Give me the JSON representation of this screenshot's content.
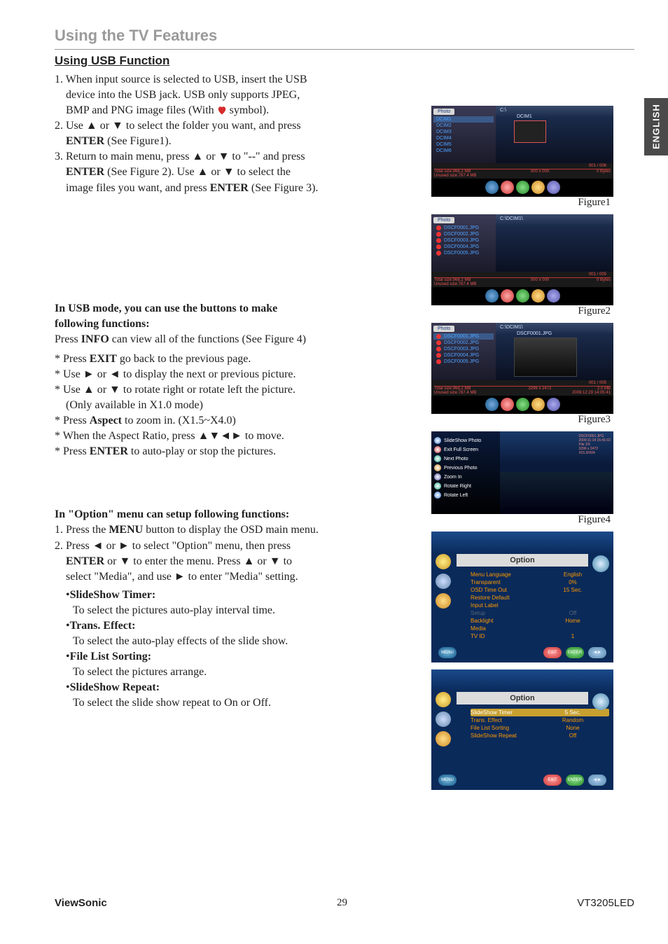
{
  "header": {
    "title": "Using the TV Features"
  },
  "section1": {
    "heading": "Using USB Function",
    "item1_a": "When input source is selected to USB, insert the USB",
    "item1_b": "device into the USB jack. USB only supports JPEG,",
    "item1_c_pre": "BMP and PNG image files (With ",
    "item1_c_post": " symbol).",
    "item2_a": "Use ▲ or ▼ to select the folder you want, and press",
    "item2_b_bold": "ENTER",
    "item2_b_rest": " (See Figure1).",
    "item3_a": "Return to main menu, press ▲ or ▼ to \"--\" and press",
    "item3_b_bold": "ENTER",
    "item3_b_rest": " (See Figure 2). Use ▲ or ▼ to select the",
    "item3_c": "image files you want, and press ",
    "item3_c_bold": "ENTER",
    "item3_c_end": " (See Figure 3)."
  },
  "section2": {
    "heading_a": "In USB mode, you can use the buttons to make",
    "heading_b": "following functions:",
    "line1_a": "Press ",
    "line1_bold": "INFO",
    "line1_b": " can view all of the functions (See Figure 4)",
    "s1_a": "Press ",
    "s1_bold": "EXIT",
    "s1_b": " go back to the previous page.",
    "s2": "Use ► or ◄ to display the next or previous picture.",
    "s3_a": "Use ▲ or ▼ to rotate right or rotate left the picture.",
    "s3_b": "(Only available in X1.0 mode)",
    "s4_a": "Press ",
    "s4_bold": "Aspect",
    "s4_b": " to zoom in. (X1.5~X4.0)",
    "s5": "When the Aspect Ratio, press ▲▼◄► to move.",
    "s6_a": "Press ",
    "s6_bold": "ENTER",
    "s6_b": " to auto-play or stop the pictures."
  },
  "section3": {
    "heading": "In \"Option\" menu can setup following functions:",
    "item1_a": "Press the ",
    "item1_bold": "MENU",
    "item1_b": " button to display the OSD main menu.",
    "item2_a": "Press ◄ or ► to select \"Option\" menu, then press",
    "item2_b_bold": "ENTER",
    "item2_b_rest": " or ▼ to enter the menu. Press ▲ or ▼ to",
    "item2_c": "select \"Media\", and use ► to enter \"Media\" setting.",
    "opt1_t": "SlideShow Timer:",
    "opt1_d": "To select the pictures auto-play interval time.",
    "opt2_t": "Trans. Effect:",
    "opt2_d": "To select the auto-play effects of the slide show.",
    "opt3_t": "File List Sorting:",
    "opt3_d": "To select the pictures arrange.",
    "opt4_t": "SlideShow Repeat:",
    "opt4_d": "To select the slide show repeat to On or Off."
  },
  "figures": {
    "fig1": {
      "caption": "Figure1",
      "tab": "Photo",
      "crumb": "C:\\",
      "sel": "DCIM1",
      "items": [
        "DCIM1",
        "DCIM2",
        "DCIM3",
        "DCIM4",
        "DCIM5",
        "DCIM6"
      ],
      "page": "001 / 006",
      "total": "Total size:968.2 MB",
      "unused": "Unused size:787.4 MB",
      "dim": "000 x 000",
      "bytes": "0 Bytes"
    },
    "fig2": {
      "caption": "Figure2",
      "tab": "Photo",
      "crumb": "C:\\DCIM1\\",
      "items": [
        "DSCF0001.JPG",
        "DSCF0002.JPG",
        "DSCF0003.JPG",
        "DSCF0004.JPG",
        "DSCF0005.JPG"
      ],
      "page": "001 / 005",
      "total": "Total size:968.2 MB",
      "unused": "Unused size:787.4 MB",
      "dim": "000 x 000",
      "bytes": "0 Bytes"
    },
    "fig3": {
      "caption": "Figure3",
      "tab": "Photo",
      "crumb": "C:\\DCIM1\\",
      "sel": "DSCF0001.JPG",
      "items": [
        "DSCF0001.JPG",
        "DSCF0002.JPG",
        "DSCF0003.JPG",
        "DSCF0004.JPG",
        "DSCF0005.JPG"
      ],
      "page": "001 / 005",
      "total": "Total size:968.2 MB",
      "unused": "Unused size:787.4 MB",
      "dim": "3296 x 2472",
      "bytes": "2.0 MB",
      "date": "2009:12:29 14:05:41"
    },
    "fig4": {
      "caption": "Figure4",
      "menu": [
        "SlideShow Photo",
        "Exit Full Screen",
        "Next Photo",
        "Previous Photo",
        "Zoom In",
        "Rotate Right",
        "Rotate Left"
      ],
      "info": [
        "DSCF0001.JPG",
        "2009:11:14 15:41:02",
        "File 1/5",
        "3296 x 2472",
        "X01.0/X04"
      ]
    },
    "opt1": {
      "title": "Option",
      "rows": [
        {
          "k": "Menu Language",
          "v": "English",
          "dim": false
        },
        {
          "k": "Transparent",
          "v": "0%",
          "dim": false
        },
        {
          "k": "OSD Time Out",
          "v": "15 Sec.",
          "dim": false
        },
        {
          "k": "Restore Default",
          "v": "",
          "dim": false
        },
        {
          "k": "Input Label",
          "v": "",
          "dim": false
        },
        {
          "k": "Setup",
          "v": "Off",
          "dim": true
        },
        {
          "k": "Backlight",
          "v": "Home",
          "dim": false
        },
        {
          "k": "Media",
          "v": "",
          "dim": false
        },
        {
          "k": "TV ID",
          "v": "1",
          "dim": false
        }
      ],
      "btns": {
        "menu": "MENU",
        "exit": "EXIT",
        "enter": "ENTER"
      }
    },
    "opt2": {
      "title": "Option",
      "rows": [
        {
          "k": "SlideShow Timer",
          "v": "5 Sec.",
          "sel": true
        },
        {
          "k": "Trans. Effect",
          "v": "Random"
        },
        {
          "k": "File List Sorting",
          "v": "None"
        },
        {
          "k": "SlideShow Repeat",
          "v": "Off"
        }
      ],
      "btns": {
        "menu": "MENU",
        "exit": "EXIT",
        "enter": "ENTER"
      }
    }
  },
  "sidetab": "ENGLISH",
  "footer": {
    "brand": "ViewSonic",
    "page": "29",
    "model": "VT3205LED"
  }
}
